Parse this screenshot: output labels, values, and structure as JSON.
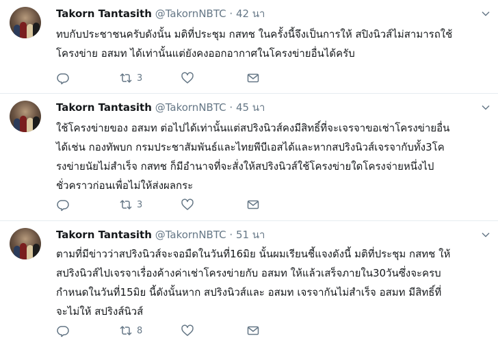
{
  "tweets": [
    {
      "name": "Takorn Tantasith",
      "handle": "@TakornNBTC",
      "dot": "·",
      "time": "42 นา",
      "text": "ทบกับประชาชนครับดังนั้น มติที่ประชุม กสทช ในครั้งนี้จึงเป็นการให้ สปิงนิวส์ไม่สามารถใช้\nโครงข่าย อสมท ได้เท่านั้นแต่ยังคงออกอากาศในโครงข่ายอื่นได้ครับ",
      "reply_count": "",
      "retweet_count": "3",
      "like_count": ""
    },
    {
      "name": "Takorn Tantasith",
      "handle": "@TakornNBTC",
      "dot": "·",
      "time": "45 นา",
      "text": "ใช้โครงข่ายของ อสมท ต่อไปได้เท่านั้นแต่สปริงนิวส์คงมีสิทธิ์ที่จะเจรจาขอเช่าโครงข่ายอื่น\nได้เช่น กองทัพบก กรมประชาสัมพันธ์และไทยพีบีเอสได้และหากสปริงนิวส์เจรจากับทั้ง3โค\nรงข่ายนัยไม่สำเร็จ กสทช ก็มีอำนาจที่จะสั่งให้สปริงนิวส์ใช้โครงข่ายใดโครงจ่ายหนึ่งไป\nชั่วคราวก่อนเพื่อไม่ให้ส่งผลกระ",
      "reply_count": "",
      "retweet_count": "3",
      "like_count": ""
    },
    {
      "name": "Takorn Tantasith",
      "handle": "@TakornNBTC",
      "dot": "·",
      "time": "51 นา",
      "text": "ตามที่มีข่าวว่าสปริงนิวส์จะจอมืดในวันที่16มิย นั้นผมเรียนชี้แจงดังนี้ มติที่ประชุม กสทช ให้\nสปริงนิวส์ไปเจรจาเรื่องค้างค่าเช่าโครงข่ายกับ อสมท ให้แล้วเสร็จภายใน30วันซึ่งจะครบ\nกำหนดในวันที่15มิย นี้ดังนั้นหาก สปริงนิวส์และ อสมท เจรจากันไม่สำเร็จ อสมท มีสิทธิ์ที่\nจะไม่ให้ สปริงส์นิวส์",
      "reply_count": "",
      "retweet_count": "8",
      "like_count": ""
    }
  ]
}
